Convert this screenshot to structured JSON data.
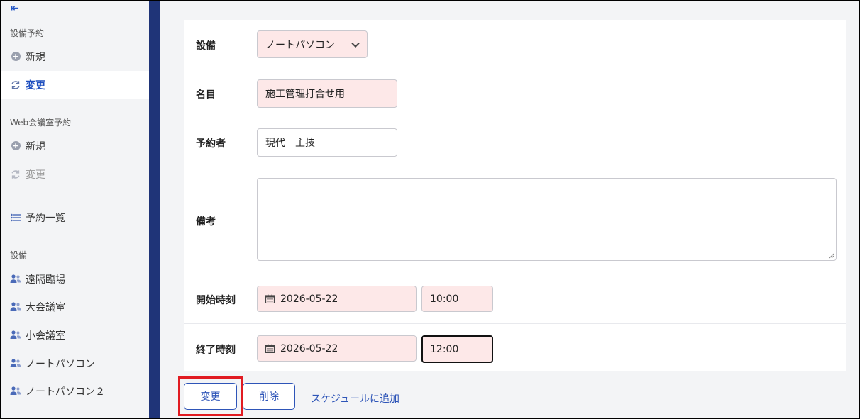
{
  "sidebar": {
    "collapse_glyph": "⇤",
    "section_equipment_reservation": "設備予約",
    "equip_new": "新規",
    "equip_change": "変更",
    "section_web_meeting": "Web会議室予約",
    "web_new": "新規",
    "web_change": "変更",
    "reservation_list": "予約一覧",
    "section_equipment": "設備",
    "equipment_items": [
      "遠隔臨場",
      "大会議室",
      "小会議室",
      "ノートパソコン",
      "ノートパソコン２"
    ]
  },
  "form": {
    "equipment_label": "設備",
    "equipment_value": "ノートパソコン",
    "title_label": "名目",
    "title_value": "施工管理打合せ用",
    "reserver_label": "予約者",
    "reserver_value": "現代　主技",
    "notes_label": "備考",
    "notes_value": "",
    "start_label": "開始時刻",
    "start_date": "2026-05-22",
    "start_time": "10:00",
    "end_label": "終了時刻",
    "end_date": "2026-05-22",
    "end_time": "12:00"
  },
  "actions": {
    "change_button": "変更",
    "delete_button": "削除",
    "add_schedule_link": "スケジュールに追加"
  },
  "colors": {
    "accent": "#2e55b8",
    "active_nav": "#1f4fbf",
    "divider": "#1f3478",
    "required_field": "#fde8e8",
    "highlight": "#e11b22"
  }
}
